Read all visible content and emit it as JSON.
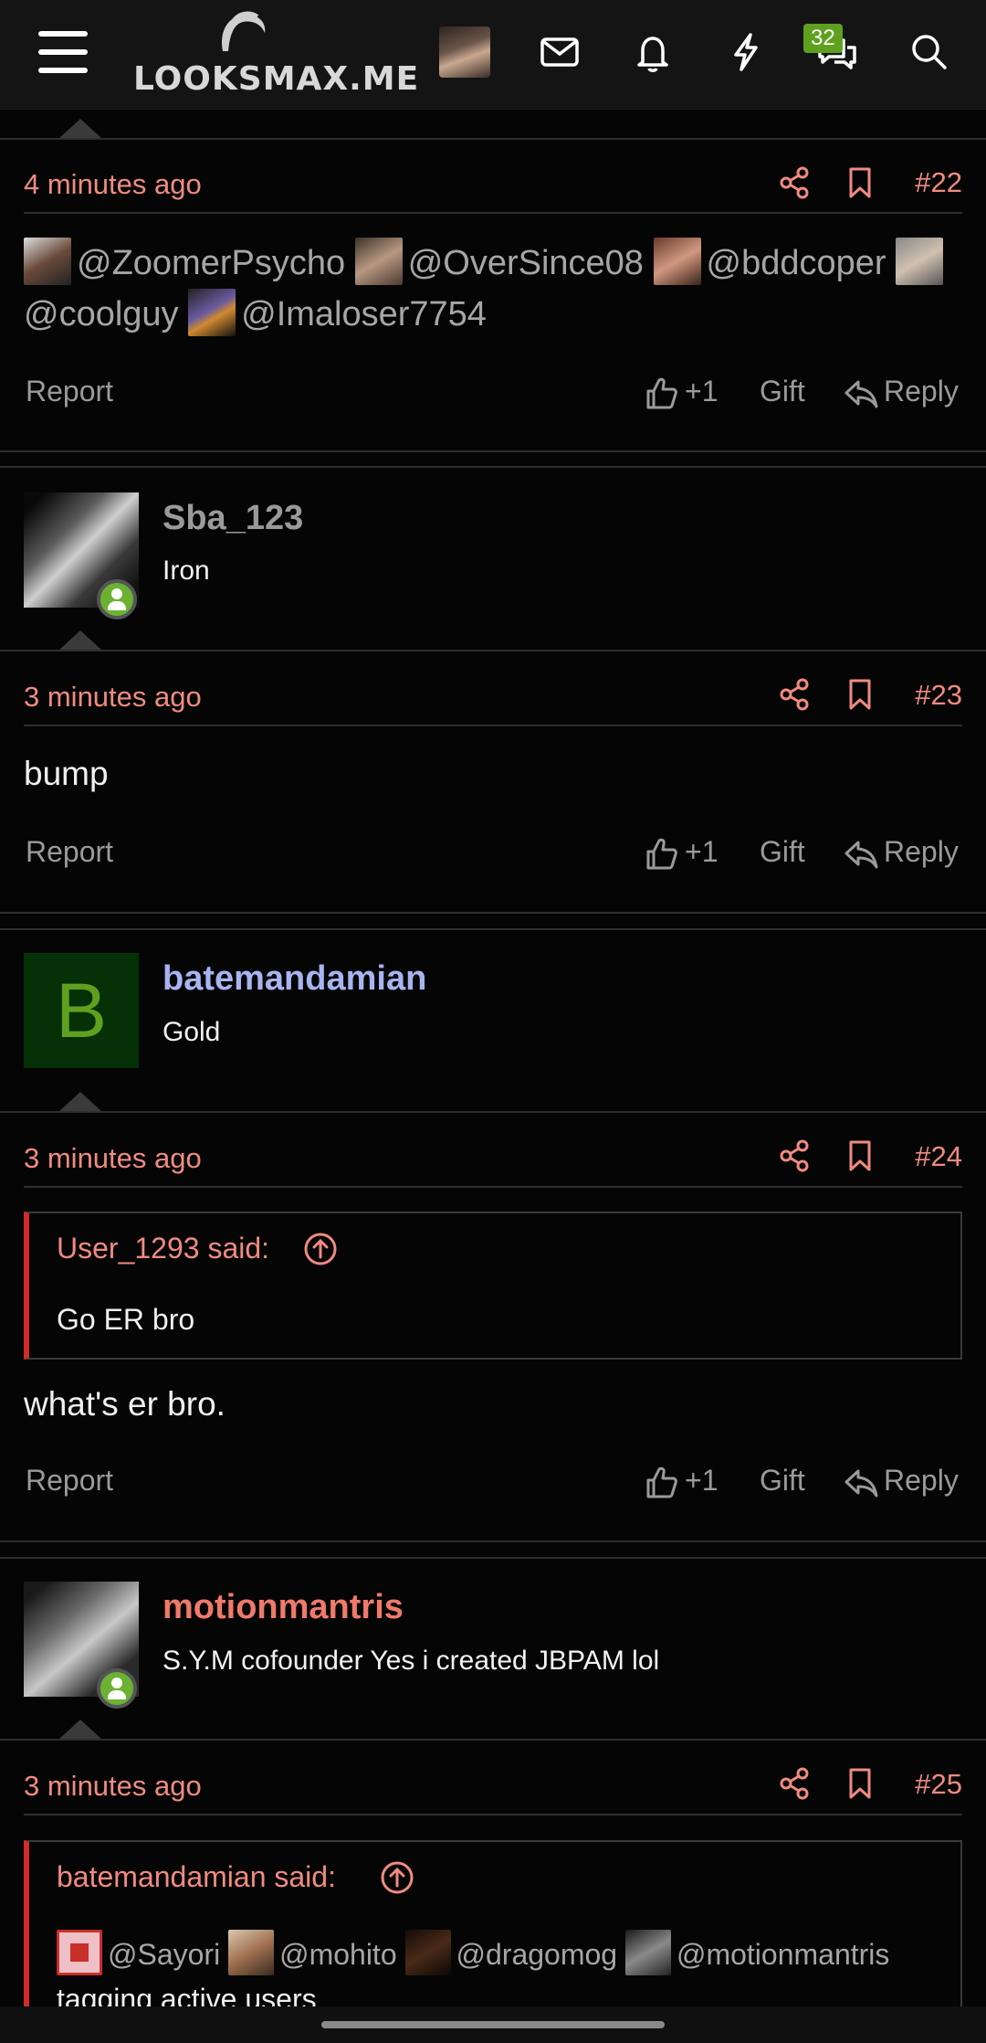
{
  "header": {
    "logo_text": "LOOKSMAX.ME",
    "badge_count": "32"
  },
  "posts": [
    {
      "time": "4 minutes ago",
      "number": "#22",
      "mentions": [
        "@ZoomerPsycho",
        "@OverSince08",
        "@bddcoper",
        "@coolguy",
        "@Imaloser7754"
      ]
    },
    {
      "username": "Sba_123",
      "user_title": "Iron",
      "time": "3 minutes ago",
      "number": "#23",
      "body": "bump"
    },
    {
      "avatar_letter": "B",
      "username": "batemandamian",
      "user_title": "Gold",
      "time": "3 minutes ago",
      "number": "#24",
      "quote_author": "User_1293 said:",
      "quote_text": "Go ER bro",
      "body": "what's er bro."
    },
    {
      "username": "motionmantris",
      "user_title": "S.Y.M cofounder Yes i created JBPAM lol",
      "time": "3 minutes ago",
      "number": "#25",
      "quote_author": "batemandamian said:",
      "quote_mentions": [
        "@Sayori",
        "@mohito",
        "@dragomog",
        "@motionmantris"
      ],
      "quote_text": "tagging active users"
    }
  ],
  "actions": {
    "report": "Report",
    "like_count": "+1",
    "gift": "Gift",
    "reply": "Reply"
  },
  "colors": {
    "accent": "#f08b80",
    "link_blue": "#a8b4f0",
    "online": "#6bb132",
    "quote_bar": "#d22a2a"
  }
}
